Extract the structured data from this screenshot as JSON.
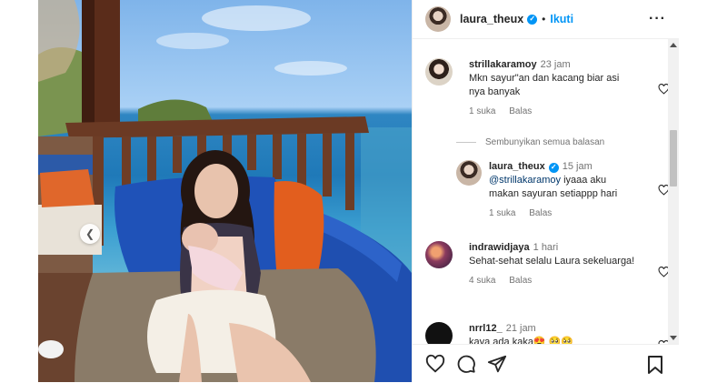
{
  "post": {
    "username": "laura_theux",
    "separator": "•",
    "follow_label": "Ikuti",
    "more_icon": "more-options-icon"
  },
  "comments": [
    {
      "username": "strillakaramoy",
      "time": "23 jam",
      "text": "Mkn sayur\"an dan kacang biar asi nya banyak",
      "likes": "1 suka",
      "reply_label": "Balas"
    },
    {
      "toggle_label": "Sembunyikan semua balasan"
    },
    {
      "username": "laura_theux",
      "time": "15 jam",
      "mention": "@strillakaramoy",
      "text": " iyaaa aku makan sayuran setiappp hari",
      "likes": "1 suka",
      "reply_label": "Balas"
    },
    {
      "username": "indrawidjaya",
      "time": "1 hari",
      "text": "Sehat-sehat selalu Laura sekeluarga!",
      "likes": "4 suka",
      "reply_label": "Balas"
    },
    {
      "username": "nrrl12_",
      "time": "21 jam",
      "text": "kaya ada kaka😍 🥺🥺"
    }
  ],
  "icons": [
    "heart-icon",
    "comment-icon",
    "share-icon",
    "bookmark-icon",
    "chevron-left-icon"
  ],
  "colors": {
    "link": "#0095f6",
    "muted": "#737373",
    "text": "#262626"
  }
}
